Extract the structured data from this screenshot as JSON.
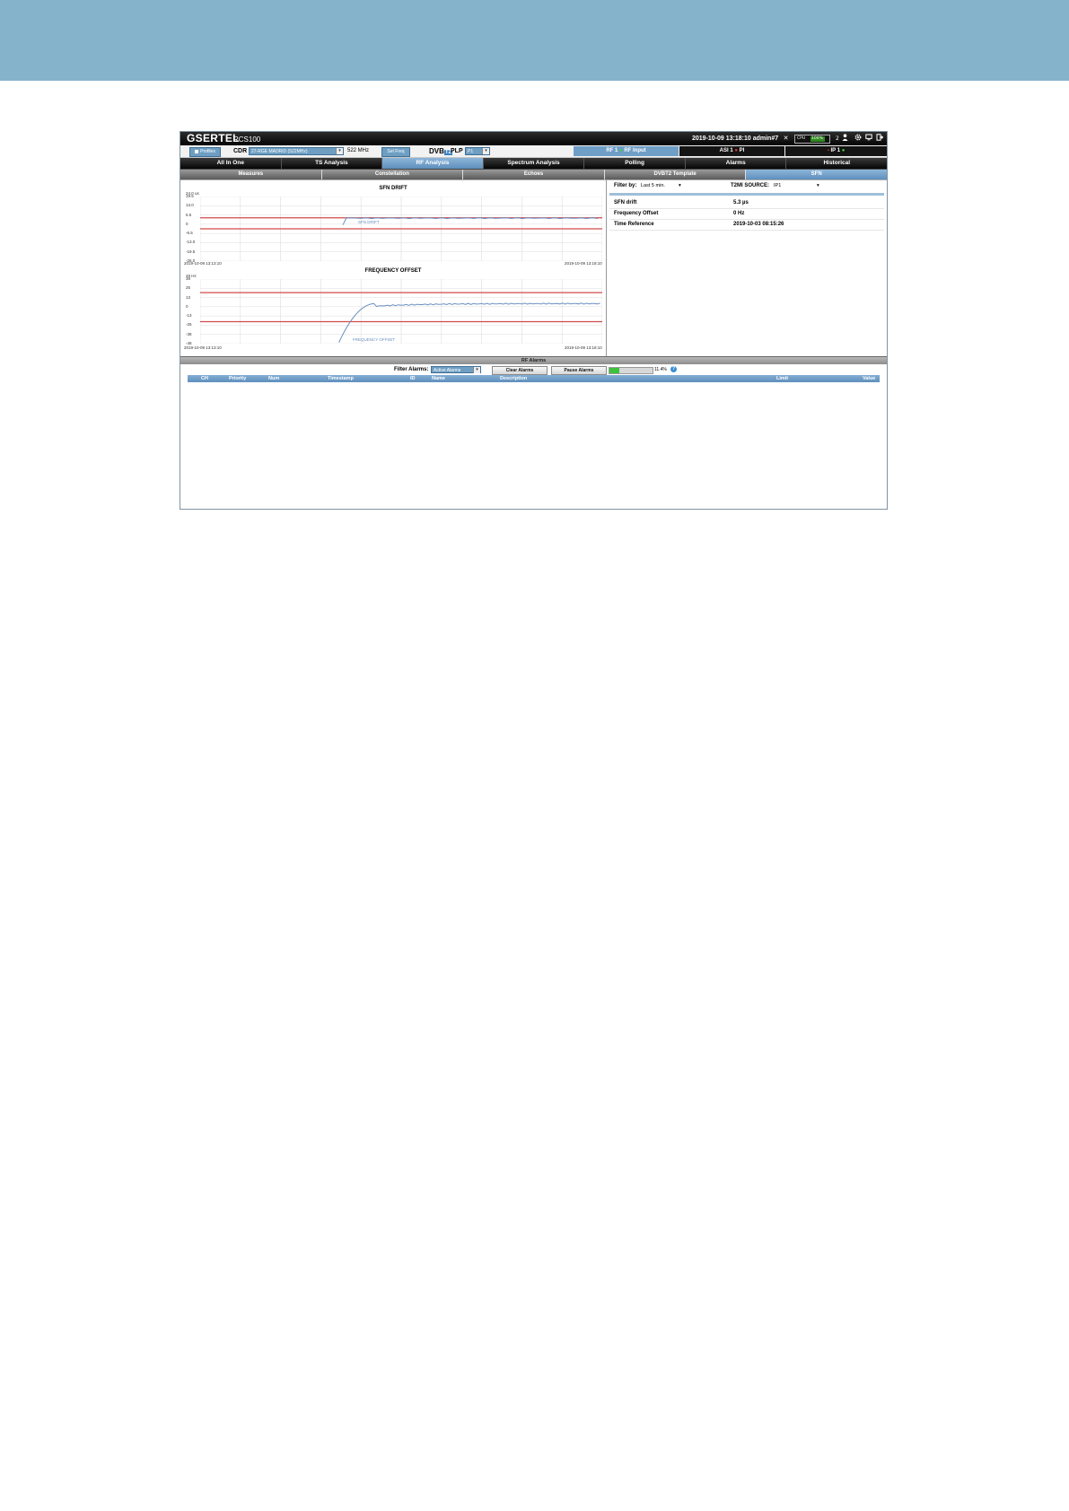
{
  "header": {
    "logo": "GSERTEL",
    "model": "RCS100",
    "datetime": "2019-10-09 13:18:10 admin#7",
    "cpu_label": "CPU",
    "cpu_value": "100%",
    "cpu_fraction": 1.0,
    "users": "2",
    "icons": [
      "user-icon",
      "gear-icon",
      "monitor-icon",
      "logout-icon"
    ]
  },
  "toolbar": {
    "profiles_label": "Profiles",
    "cdr_label": "CDR",
    "cdr_value": "27-RGE MADRID (522MHz)",
    "freq": "522 MHz",
    "set_freq_label": "Set Freq",
    "dvb_prefix": "DVB",
    "dvb_suffix": "T2",
    "plp_label": "PLP",
    "plp_value": "P1",
    "rf_input": {
      "prefix": "RF 1",
      "label": "RF Input"
    },
    "asi_input": {
      "prefix": "ASI 1",
      "label": "PI"
    },
    "ip_input": {
      "label": "IP 1"
    }
  },
  "tabs": [
    "All In One",
    "TS Analysis",
    "RF Analysis",
    "Spectrum Analysis",
    "Polling",
    "Alarms",
    "Historical"
  ],
  "subtabs": [
    "Measures",
    "Constellation",
    "Echoes",
    "DVBT2 Template",
    "SFN"
  ],
  "sfn_drift_chart": {
    "title": "SFN DRIFT",
    "unit": "24.0  us",
    "yticks": [
      "19.5",
      "13.0",
      "6.5",
      "0",
      "-6.5",
      "-13.0",
      "-19.5",
      "-26.0"
    ],
    "x_start": "2019-10-09 13:13:10",
    "x_end": "2019-10-09 13:18:10",
    "series_label": "SFN DRIFT"
  },
  "freq_offset_chart": {
    "title": "FREQUENCY OFFSET",
    "unit": "48  Hz",
    "yticks": [
      "38",
      "25",
      "13",
      "0",
      "-13",
      "-25",
      "-38",
      "-48"
    ],
    "x_start": "2019-10-09 13:13:10",
    "x_end": "2019-10-09 13:18:10",
    "series_label": "FREQUENCY OFFSET"
  },
  "side": {
    "filter_label": "Filter by:",
    "filter_value": "Last 5 min.",
    "t2mi_label": "T2MI SOURCE:",
    "t2mi_value": "IP1",
    "rows": [
      {
        "label": "SFN drift",
        "value": "5.3 µs"
      },
      {
        "label": "Frequency Offset",
        "value": "0 Hz"
      },
      {
        "label": "Time Reference",
        "value": "2019-10-03 08:15:26"
      }
    ]
  },
  "alarms": {
    "title": "RF Alarms",
    "filter_label": "Filter Alarms:",
    "filter_value": "Active Alarms",
    "clear_label": "Clear Alarms",
    "pause_label": "Pause Alarms",
    "progress_fraction": 0.114,
    "progress_label": "11.4%",
    "help": "?",
    "columns": [
      "CH",
      "Priority",
      "Num",
      "Timestamp",
      "ID",
      "Name",
      "Description",
      "Limit",
      "Value"
    ]
  },
  "colors": {
    "banner": "#86b3cc",
    "accent": "#6e9fc3",
    "threshold": "#d24a4a",
    "series": "#6a8fbf"
  }
}
